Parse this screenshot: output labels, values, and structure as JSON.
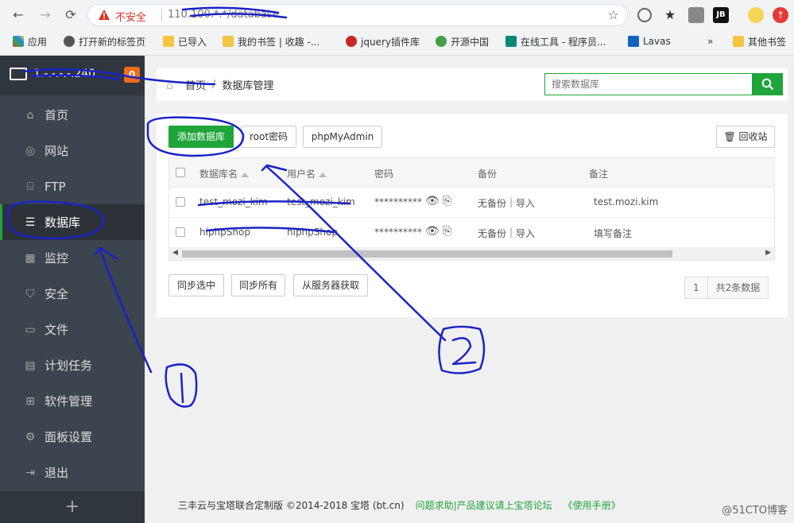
{
  "browser": {
    "insecure_label": "不安全",
    "url": "110.100.*.*/database",
    "bookmarks": [
      "应用",
      "打开新的标签页",
      "已导入",
      "我的书签 | 收趣 -...",
      "jquery插件库",
      "开源中国",
      "在线工具 - 程序员...",
      "Lavas",
      "»",
      "其他书签"
    ]
  },
  "sidebar": {
    "host": "1.-.-.-.-.240",
    "badge": "0",
    "items": [
      {
        "label": "首页",
        "icon": "home-icon"
      },
      {
        "label": "网站",
        "icon": "globe-icon"
      },
      {
        "label": "FTP",
        "icon": "ftp-icon"
      },
      {
        "label": "数据库",
        "icon": "database-icon"
      },
      {
        "label": "监控",
        "icon": "monitor-chart-icon"
      },
      {
        "label": "安全",
        "icon": "shield-icon"
      },
      {
        "label": "文件",
        "icon": "folder-icon"
      },
      {
        "label": "计划任务",
        "icon": "calendar-icon"
      },
      {
        "label": "软件管理",
        "icon": "grid-icon"
      },
      {
        "label": "面板设置",
        "icon": "gear-icon"
      },
      {
        "label": "退出",
        "icon": "logout-icon"
      }
    ],
    "add_label": "+"
  },
  "topbar": {
    "crumb_home": "首页",
    "crumb_sep": "/",
    "crumb_current": "数据库管理",
    "search_placeholder": "搜索数据库"
  },
  "toolbar": {
    "add_db": "添加数据库",
    "root_pw": "root密码",
    "phpmyadmin": "phpMyAdmin",
    "recycle": "回收站"
  },
  "table": {
    "headers": [
      "数据库名",
      "用户名",
      "密码",
      "备份",
      "备注"
    ],
    "rows": [
      {
        "name": "test_mozi_kim",
        "user": "test_mozi_kim",
        "password": "**********",
        "backup": "无备份",
        "sep": "|",
        "import": "导入",
        "note": "test.mozi.kim"
      },
      {
        "name": "hiphpShop",
        "user": "hiphpShop",
        "password": "**********",
        "backup": "无备份",
        "sep": "|",
        "import": "导入",
        "note": "填写备注"
      }
    ]
  },
  "actions": {
    "sync_selected": "同步选中",
    "sync_all": "同步所有",
    "sync_from_server": "从服务器获取"
  },
  "pager": {
    "page": "1",
    "total": "共2条数据"
  },
  "footer": {
    "copyright": "三丰云与宝塔联合定制版 ©2014-2018 宝塔 (bt.cn)",
    "forum": "问题求助|产品建议请上宝塔论坛",
    "manual": "《使用手册》"
  },
  "watermark": "@51CTO博客",
  "colors": {
    "accent": "#20a53a",
    "sidebar": "#3c444d",
    "annotation": "#1a22c8"
  }
}
